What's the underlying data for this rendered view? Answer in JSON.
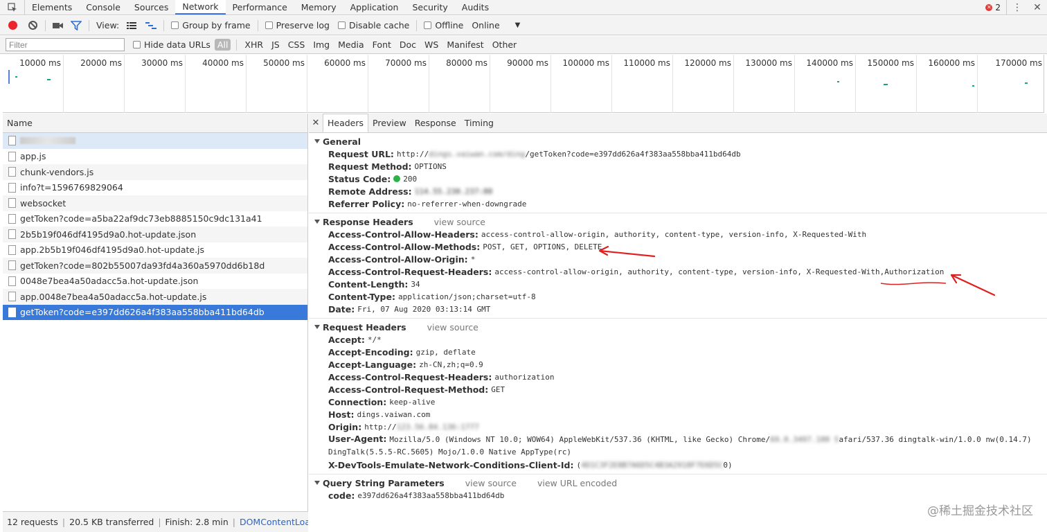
{
  "devtools": {
    "tabs": [
      "Elements",
      "Console",
      "Sources",
      "Network",
      "Performance",
      "Memory",
      "Application",
      "Security",
      "Audits"
    ],
    "active_tab": "Network",
    "error_count": "2"
  },
  "toolbar": {
    "view_label": "View:",
    "group_by_frame": "Group by frame",
    "preserve_log": "Preserve log",
    "disable_cache": "Disable cache",
    "offline": "Offline",
    "throttle_value": "Online"
  },
  "filter": {
    "placeholder": "Filter",
    "hide_data_urls": "Hide data URLs",
    "types": [
      "All",
      "XHR",
      "JS",
      "CSS",
      "Img",
      "Media",
      "Font",
      "Doc",
      "WS",
      "Manifest",
      "Other"
    ],
    "active_type": "All"
  },
  "overview": {
    "ticks": [
      "10000 ms",
      "20000 ms",
      "30000 ms",
      "40000 ms",
      "50000 ms",
      "60000 ms",
      "70000 ms",
      "80000 ms",
      "90000 ms",
      "100000 ms",
      "110000 ms",
      "120000 ms",
      "130000 ms",
      "140000 ms",
      "150000 ms",
      "160000 ms",
      "170000 ms"
    ]
  },
  "request_list": {
    "header": "Name",
    "rows": [
      "",
      "app.js",
      "chunk-vendors.js",
      "info?t=1596769829064",
      "websocket",
      "getToken?code=a5ba22af9dc73eb8885150c9dc131a41",
      "2b5b19f046df4195d9a0.hot-update.json",
      "app.2b5b19f046df4195d9a0.hot-update.js",
      "getToken?code=802b55007da93fd4a360a5970dd6b18d",
      "0048e7bea4a50adacc5a.hot-update.json",
      "app.0048e7bea4a50adacc5a.hot-update.js",
      "getToken?code=e397dd626a4f383aa558bba411bd64db"
    ],
    "selected_index": 11
  },
  "status": {
    "requests": "12 requests",
    "transferred": "20.5 KB transferred",
    "finish": "Finish: 2.8 min",
    "dcl": "DOMContentLoaded: ..."
  },
  "detail": {
    "tabs": [
      "Headers",
      "Preview",
      "Response",
      "Timing"
    ],
    "active_tab": "Headers",
    "general": {
      "title": "General",
      "request_url_key": "Request URL:",
      "request_url_prefix": "http://",
      "request_url_hidden": "dings.vaiwan.com/ding",
      "request_url_suffix": "/getToken?code=e397dd626a4f383aa558bba411bd64db",
      "method_key": "Request Method:",
      "method": "OPTIONS",
      "status_key": "Status Code:",
      "status": "200",
      "remote_key": "Remote Address:",
      "remote_hidden": "114.55.230.237:80",
      "referrer_key": "Referrer Policy:",
      "referrer": "no-referrer-when-downgrade"
    },
    "response_headers": {
      "title": "Response Headers",
      "view_source": "view source",
      "items": [
        {
          "k": "Access-Control-Allow-Headers:",
          "v": "access-control-allow-origin, authority, content-type, version-info, X-Requested-With"
        },
        {
          "k": "Access-Control-Allow-Methods:",
          "v": "POST, GET, OPTIONS, DELETE"
        },
        {
          "k": "Access-Control-Allow-Origin:",
          "v": "*"
        },
        {
          "k": "Access-Control-Request-Headers:",
          "v": "access-control-allow-origin, authority, content-type, version-info, X-Requested-With,Authorization"
        },
        {
          "k": "Content-Length:",
          "v": "34"
        },
        {
          "k": "Content-Type:",
          "v": "application/json;charset=utf-8"
        },
        {
          "k": "Date:",
          "v": "Fri, 07 Aug 2020 03:13:14 GMT"
        }
      ]
    },
    "request_headers": {
      "title": "Request Headers",
      "view_source": "view source",
      "items": [
        {
          "k": "Accept:",
          "v": "*/*"
        },
        {
          "k": "Accept-Encoding:",
          "v": "gzip, deflate"
        },
        {
          "k": "Accept-Language:",
          "v": "zh-CN,zh;q=0.9"
        },
        {
          "k": "Access-Control-Request-Headers:",
          "v": "authorization"
        },
        {
          "k": "Access-Control-Request-Method:",
          "v": "GET"
        },
        {
          "k": "Connection:",
          "v": "keep-alive"
        },
        {
          "k": "Host:",
          "v": "dings.vaiwan.com"
        }
      ],
      "origin_key": "Origin:",
      "origin_prefix": "http://",
      "origin_hidden": "123.56.84.136:1777",
      "ua_key": "User-Agent:",
      "ua_a": "Mozilla/5.0 (Windows NT 10.0; WOW64) AppleWebKit/537.36 (KHTML, like Gecko) Chrome/",
      "ua_hidden": "69.0.3497.100 S",
      "ua_b": "afari/537.36 dingtalk-win/1.0.0 nw(0.14.7) DingTalk(5.5.5-RC.5605) Mojo/1.0.0 Native AppType(rc)",
      "emu_key": "X-DevTools-Emulate-Network-Conditions-Client-Id:",
      "emu_open": "(",
      "emu_hidden": "4D1C3F2E8B7A6D5C4B3A2918F7E6D5C",
      "emu_close": "0)"
    },
    "query": {
      "title": "Query String Parameters",
      "view_source": "view source",
      "view_url_encoded": "view URL encoded",
      "code_key": "code:",
      "code": "e397dd626a4f383aa558bba411bd64db"
    }
  },
  "watermark": "@稀土掘金技术社区",
  "colors": {
    "accent": "#3879d9",
    "record": "#e8262b",
    "annotation": "#e02020",
    "status_ok": "#2ab34a"
  }
}
